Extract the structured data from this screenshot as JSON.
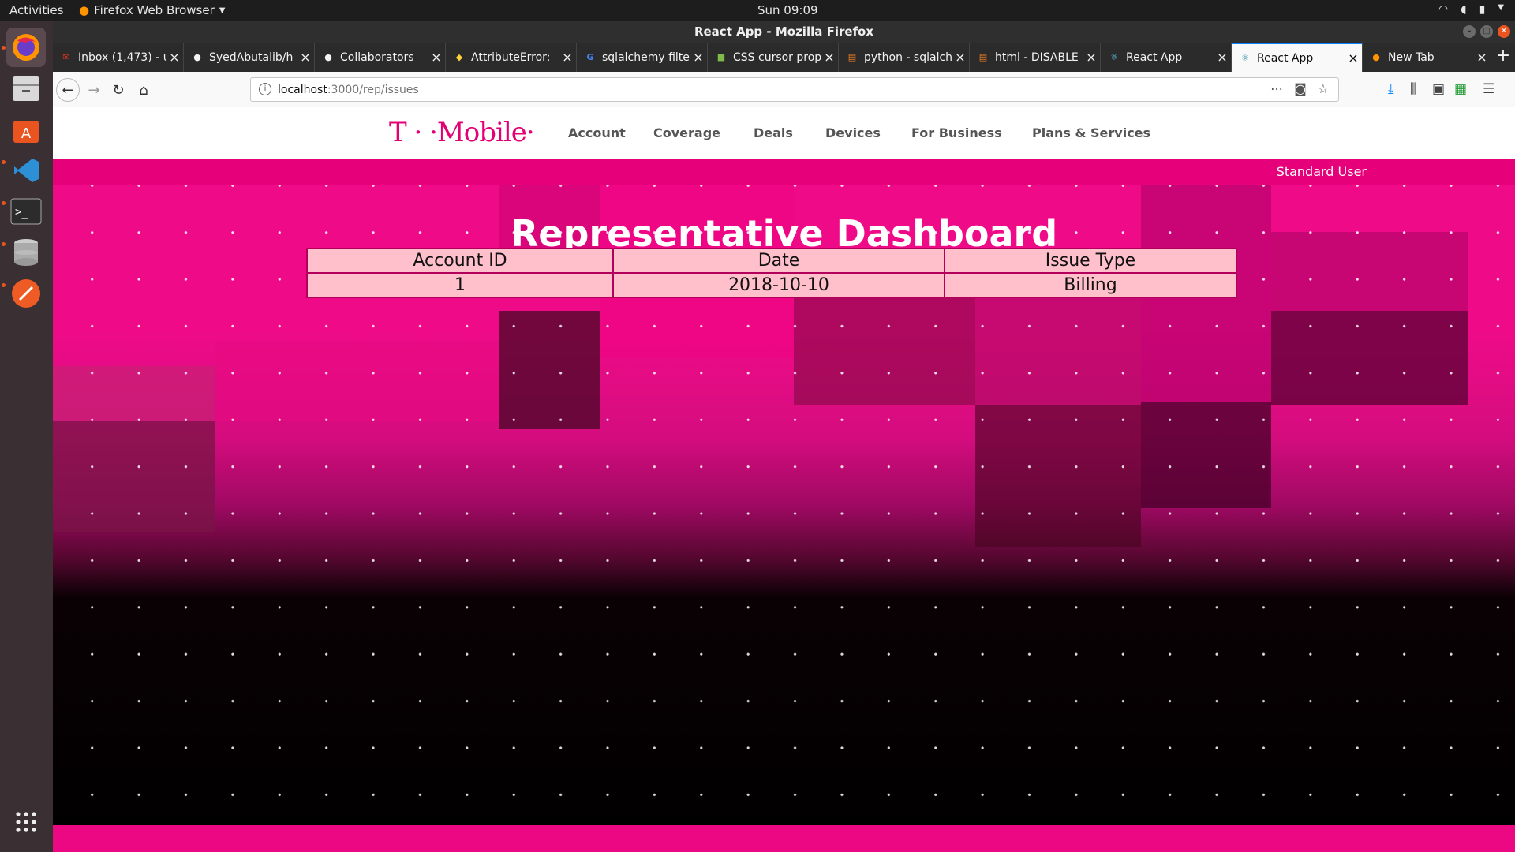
{
  "system": {
    "activities": "Activities",
    "app_name": "Firefox Web Browser",
    "clock": "Sun 09:09"
  },
  "window": {
    "title": "React App - Mozilla Firefox"
  },
  "tabs": [
    {
      "label": "Inbox (1,473) - u",
      "icon": "gmail-icon"
    },
    {
      "label": "SyedAbutalib/h",
      "icon": "github-icon"
    },
    {
      "label": "Collaborators",
      "icon": "github-icon"
    },
    {
      "label": "AttributeError:",
      "icon": "python-icon"
    },
    {
      "label": "sqlalchemy filte",
      "icon": "google-icon"
    },
    {
      "label": "CSS cursor prop",
      "icon": "caniuse-icon"
    },
    {
      "label": "python - sqlalch",
      "icon": "stackoverflow-icon"
    },
    {
      "label": "html - DISABLE",
      "icon": "stackoverflow-icon"
    },
    {
      "label": "React App",
      "icon": "react-icon"
    },
    {
      "label": "React App",
      "icon": "react-icon",
      "active": true
    },
    {
      "label": "New Tab",
      "icon": "firefox-icon"
    }
  ],
  "urlbar": {
    "host": "localhost",
    "path": ":3000/rep/issues"
  },
  "site": {
    "logo": "T · ·Mobile·",
    "nav": [
      "Account",
      "Coverage",
      "Deals",
      "Devices",
      "For Business",
      "Plans & Services"
    ],
    "user": "Standard User",
    "heading": "Representative Dashboard"
  },
  "issues_table": {
    "headers": [
      "Account ID",
      "Date",
      "Issue Type"
    ],
    "rows": [
      [
        "1",
        "2018-10-10",
        "Billing"
      ]
    ]
  },
  "colors": {
    "brand": "#e20074",
    "table_cell": "#ffc0cb"
  }
}
